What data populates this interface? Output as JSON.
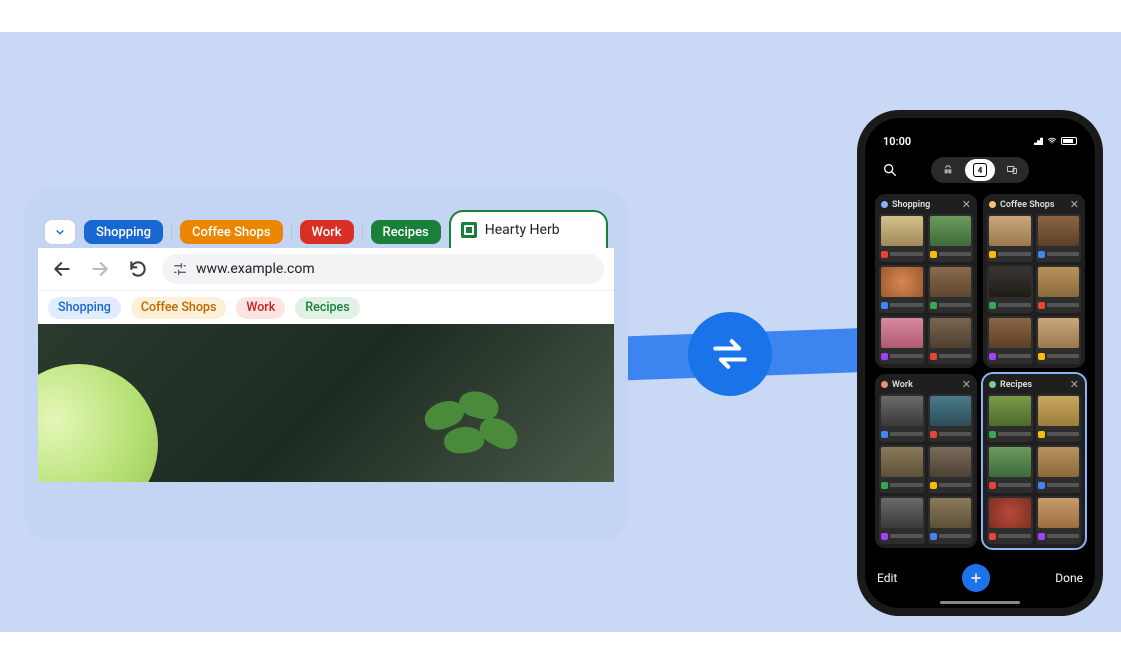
{
  "desktop": {
    "groups": [
      {
        "label": "Shopping"
      },
      {
        "label": "Coffee Shops"
      },
      {
        "label": "Work"
      },
      {
        "label": "Recipes"
      }
    ],
    "active_tab_title": "Hearty Herb",
    "url": "www.example.com",
    "bookmarks": [
      {
        "label": "Shopping"
      },
      {
        "label": "Coffee Shops"
      },
      {
        "label": "Work"
      },
      {
        "label": "Recipes"
      }
    ]
  },
  "phone": {
    "time": "10:00",
    "tab_count": "4",
    "groups": [
      {
        "title": "Shopping"
      },
      {
        "title": "Coffee Shops"
      },
      {
        "title": "Work"
      },
      {
        "title": "Recipes"
      }
    ],
    "footer": {
      "edit": "Edit",
      "done": "Done"
    }
  }
}
